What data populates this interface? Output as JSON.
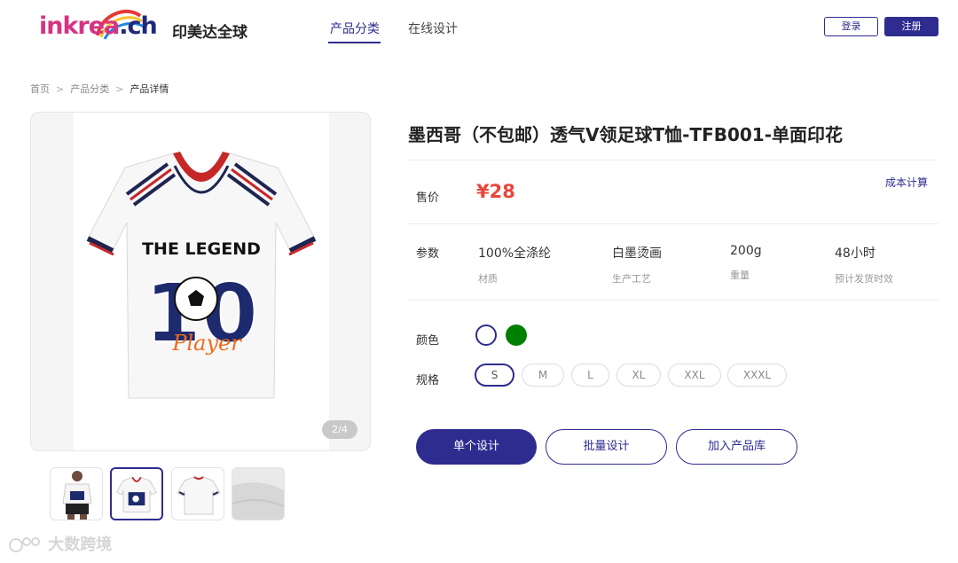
{
  "header": {
    "logo_text_part1": "inkrea",
    "logo_text_part2": ".ch",
    "brand_name": "印美达全球",
    "nav": [
      {
        "label": "产品分类",
        "active": true
      },
      {
        "label": "在线设计",
        "active": false
      }
    ],
    "login_label": "登录",
    "register_label": "注册"
  },
  "breadcrumb": [
    "首页",
    "产品分类",
    "产品详情"
  ],
  "breadcrumb_separator": ">",
  "gallery": {
    "counter": "2/4",
    "main_shirt_text": "THE LEGEND",
    "main_shirt_number": "10",
    "main_shirt_script": "Player",
    "thumbnails": [
      {
        "icon": "model-wearing-shirt",
        "active": false
      },
      {
        "icon": "shirt-front",
        "active": true
      },
      {
        "icon": "shirt-back",
        "active": false
      },
      {
        "icon": "fabric-closeup",
        "active": false
      }
    ]
  },
  "product": {
    "title": "墨西哥（不包邮）透气V领足球T恤-TFB001-单面印花",
    "price_label": "售价",
    "price": "¥28",
    "cost_link": "成本计算",
    "params_label": "参数",
    "params": [
      {
        "value": "100%全涤纶",
        "key": "材质"
      },
      {
        "value": "白墨烫画",
        "key": "生产工艺"
      },
      {
        "value": "200g",
        "key": "重量"
      },
      {
        "value": "48小时",
        "key": "预计发货时效"
      }
    ],
    "color_label": "颜色",
    "colors": [
      {
        "name": "white",
        "hex": "#ffffff",
        "selected": true
      },
      {
        "name": "green",
        "hex": "#008000",
        "selected": false
      }
    ],
    "spec_label": "规格",
    "sizes": [
      {
        "label": "S",
        "selected": true
      },
      {
        "label": "M",
        "selected": false
      },
      {
        "label": "L",
        "selected": false
      },
      {
        "label": "XL",
        "selected": false
      },
      {
        "label": "XXL",
        "selected": false
      },
      {
        "label": "XXXL",
        "selected": false
      }
    ],
    "actions": {
      "single_design": "单个设计",
      "batch_design": "批量设计",
      "add_library": "加入产品库"
    }
  },
  "colors_theme": {
    "accent": "#2e2c8f",
    "price": "#e8453c"
  },
  "watermark": "大数跨境"
}
